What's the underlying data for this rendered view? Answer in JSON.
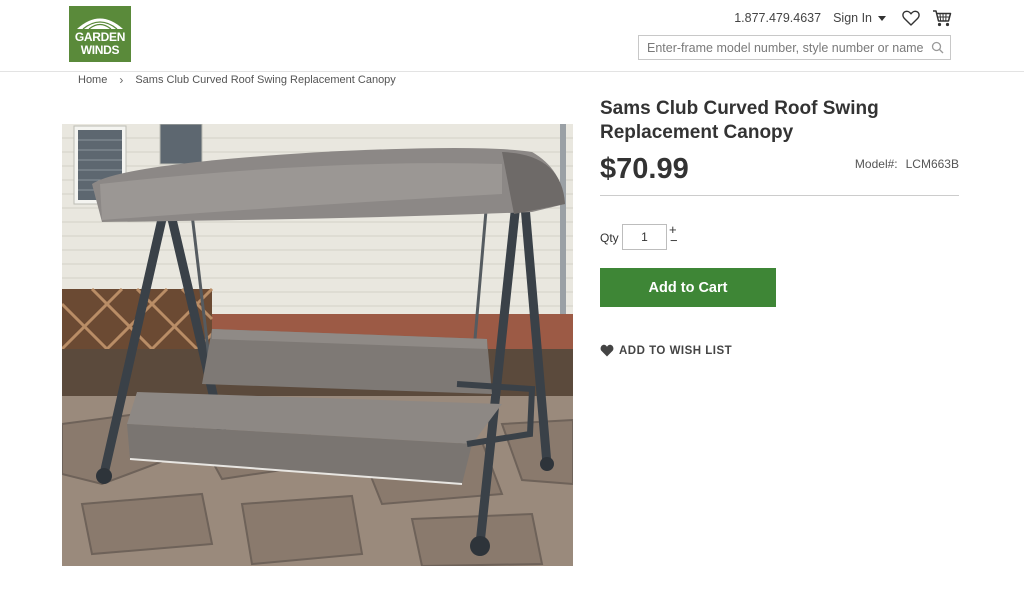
{
  "header": {
    "logo": {
      "line1": "GARDEN",
      "line2": "WINDS"
    },
    "phone": "1.877.479.4637",
    "signin_label": "Sign In",
    "wishlist_icon": "heart-icon",
    "cart_icon": "cart-icon",
    "search": {
      "placeholder": "Enter-frame model number, style number or name",
      "value": ""
    }
  },
  "breadcrumb": {
    "items": [
      "Home",
      "Sams Club Curved Roof Swing Replacement Canopy"
    ],
    "separator": "›"
  },
  "product": {
    "title": "Sams Club Curved Roof Swing Replacement Canopy",
    "price": "$70.99",
    "model_label": "Model#:",
    "model_value": "LCM663B",
    "qty_label": "Qty",
    "qty_value": "1",
    "qty_plus": "+",
    "qty_minus": "−",
    "add_to_cart_label": "Add to Cart",
    "wishlist_label": "ADD TO WISH LIST"
  },
  "colors": {
    "brand_green": "#5a8a3a",
    "button_green": "#3e8636"
  }
}
